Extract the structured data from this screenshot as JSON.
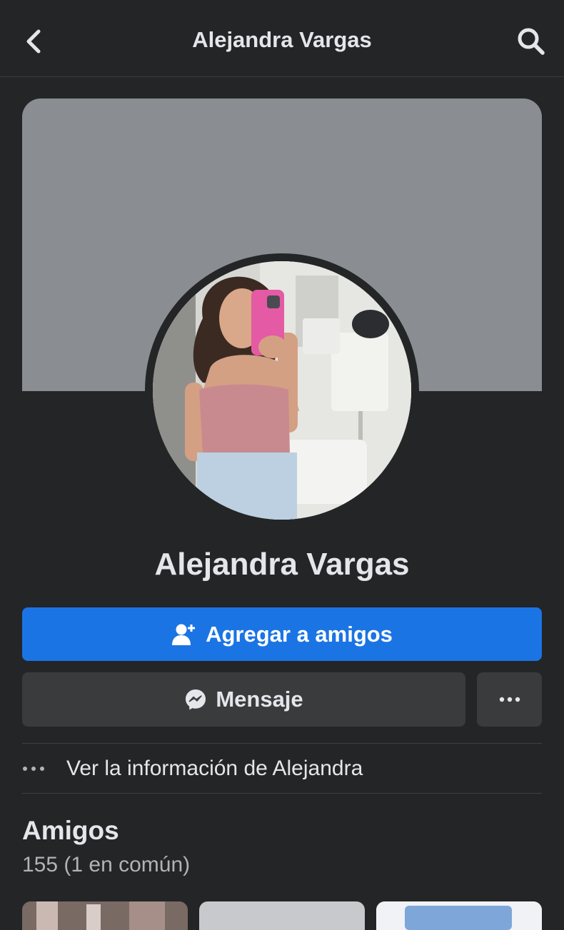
{
  "header": {
    "title": "Alejandra Vargas",
    "back_icon": "chevron-left-icon",
    "search_icon": "search-icon"
  },
  "profile": {
    "name": "Alejandra Vargas"
  },
  "actions": {
    "add_friend_label": "Agregar a amigos",
    "message_label": "Mensaje",
    "more_icon": "more-dots-icon"
  },
  "info": {
    "label": "Ver la información de Alejandra"
  },
  "friends": {
    "title": "Amigos",
    "count_text": "155 (1 en común)"
  },
  "colors": {
    "background": "#242526",
    "primary": "#1b74e4",
    "secondary_button": "#3a3b3c",
    "cover": "#8a8d92",
    "text_primary": "#e4e6eb",
    "text_secondary": "#b0b3b8"
  }
}
